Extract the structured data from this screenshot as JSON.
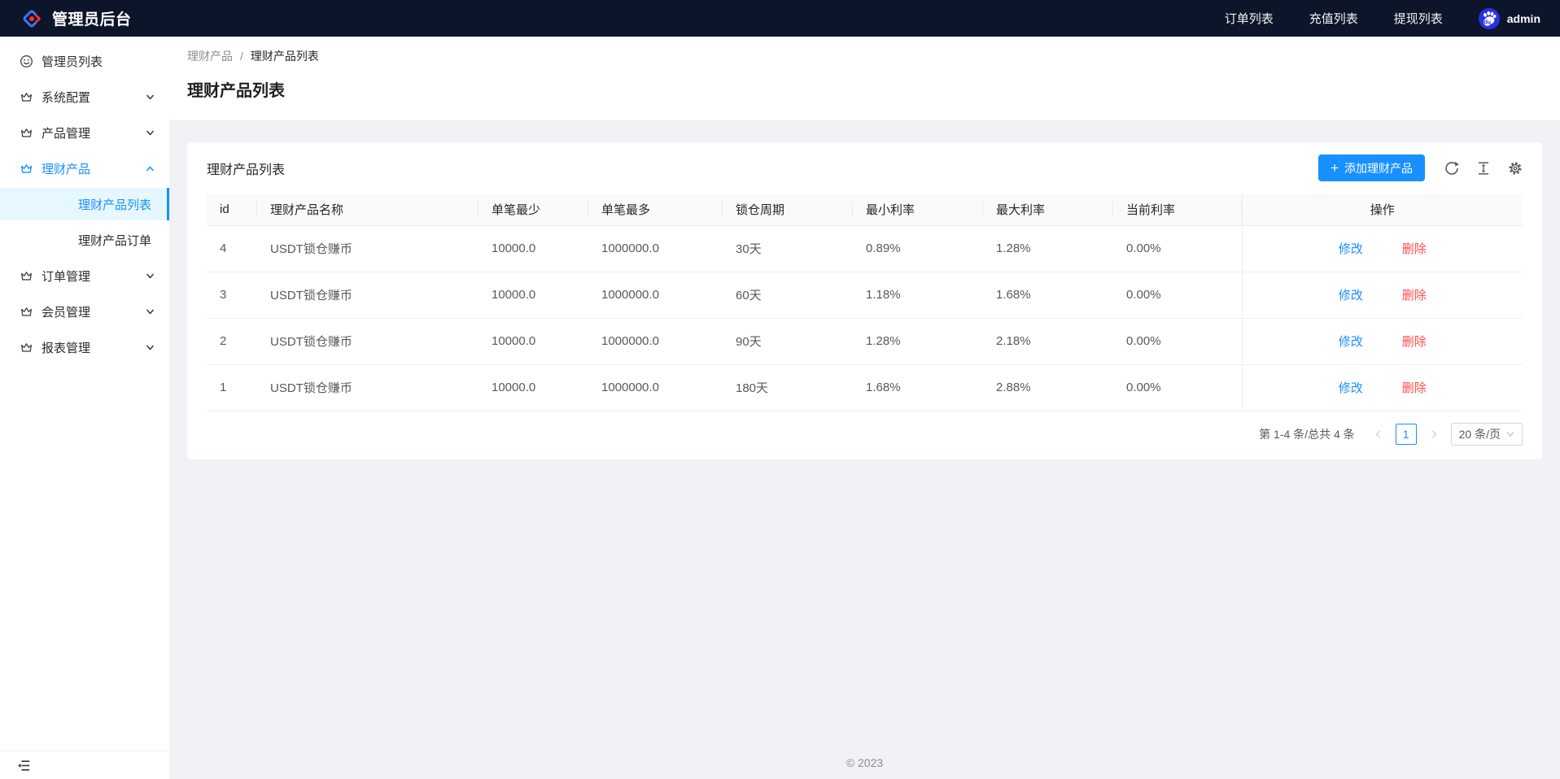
{
  "topbar": {
    "brand": "管理员后台",
    "nav": [
      "订单列表",
      "充值列表",
      "提现列表"
    ],
    "username": "admin"
  },
  "sidebar": {
    "items": [
      {
        "label": "管理员列表"
      },
      {
        "label": "系统配置"
      },
      {
        "label": "产品管理"
      },
      {
        "label": "理财产品"
      },
      {
        "label": "理财产品列表"
      },
      {
        "label": "理财产品订单"
      },
      {
        "label": "订单管理"
      },
      {
        "label": "会员管理"
      },
      {
        "label": "报表管理"
      }
    ]
  },
  "breadcrumb": {
    "parent": "理财产品",
    "separator": "/",
    "current": "理财产品列表"
  },
  "page": {
    "title": "理财产品列表"
  },
  "card": {
    "title": "理财产品列表",
    "plus": "+",
    "add_button": "添加理财产品"
  },
  "table": {
    "columns": [
      "id",
      "理财产品名称",
      "单笔最少",
      "单笔最多",
      "锁仓周期",
      "最小利率",
      "最大利率",
      "当前利率",
      "操作"
    ],
    "rows": [
      {
        "id": "4",
        "name": "USDT锁仓赚币",
        "min": "10000.0",
        "max": "1000000.0",
        "period": "30天",
        "min_rate": "0.89%",
        "max_rate": "1.28%",
        "cur_rate": "0.00%"
      },
      {
        "id": "3",
        "name": "USDT锁仓赚币",
        "min": "10000.0",
        "max": "1000000.0",
        "period": "60天",
        "min_rate": "1.18%",
        "max_rate": "1.68%",
        "cur_rate": "0.00%"
      },
      {
        "id": "2",
        "name": "USDT锁仓赚币",
        "min": "10000.0",
        "max": "1000000.0",
        "period": "90天",
        "min_rate": "1.28%",
        "max_rate": "2.18%",
        "cur_rate": "0.00%"
      },
      {
        "id": "1",
        "name": "USDT锁仓赚币",
        "min": "10000.0",
        "max": "1000000.0",
        "period": "180天",
        "min_rate": "1.68%",
        "max_rate": "2.88%",
        "cur_rate": "0.00%"
      }
    ],
    "actions": {
      "edit": "修改",
      "delete": "删除"
    }
  },
  "pagination": {
    "total": "第 1-4 条/总共 4 条",
    "page": "1",
    "page_size": "20 条/页"
  },
  "footer": {
    "copyright": "© 2023"
  },
  "colors": {
    "accent": "#1890ff",
    "danger": "#ff4d4f",
    "topbar_bg": "#0c1529",
    "selected_bg": "#e6f7ff"
  }
}
